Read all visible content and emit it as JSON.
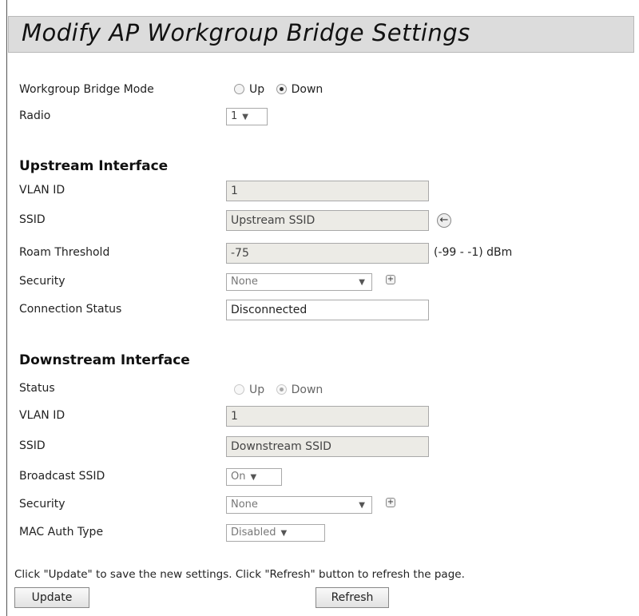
{
  "page_title": "Modify AP Workgroup Bridge Settings",
  "wgb": {
    "mode_label": "Workgroup Bridge Mode",
    "mode_options": [
      "Up",
      "Down"
    ],
    "mode_selected": "Down",
    "radio_label": "Radio",
    "radio_value": "1"
  },
  "upstream": {
    "heading": "Upstream Interface",
    "vlan_label": "VLAN ID",
    "vlan_value": "1",
    "ssid_label": "SSID",
    "ssid_value": "Upstream SSID",
    "roam_label": "Roam Threshold",
    "roam_value": "-75",
    "roam_unit": "(-99 - -1) dBm",
    "security_label": "Security",
    "security_value": "None",
    "status_label": "Connection Status",
    "status_value": "Disconnected"
  },
  "downstream": {
    "heading": "Downstream Interface",
    "status_label": "Status",
    "status_options": [
      "Up",
      "Down"
    ],
    "status_selected": "Down",
    "vlan_label": "VLAN ID",
    "vlan_value": "1",
    "ssid_label": "SSID",
    "ssid_value": "Downstream SSID",
    "broadcast_label": "Broadcast SSID",
    "broadcast_value": "On",
    "security_label": "Security",
    "security_value": "None",
    "mac_auth_label": "MAC Auth Type",
    "mac_auth_value": "Disabled"
  },
  "footer": {
    "hint": "Click \"Update\" to save the new settings. Click \"Refresh\" button to refresh the page.",
    "update_label": "Update",
    "refresh_label": "Refresh"
  },
  "icons": {
    "dropdown": "dropdown-arrow-icon",
    "expand": "plus-icon",
    "scan": "arrow-left-icon"
  }
}
